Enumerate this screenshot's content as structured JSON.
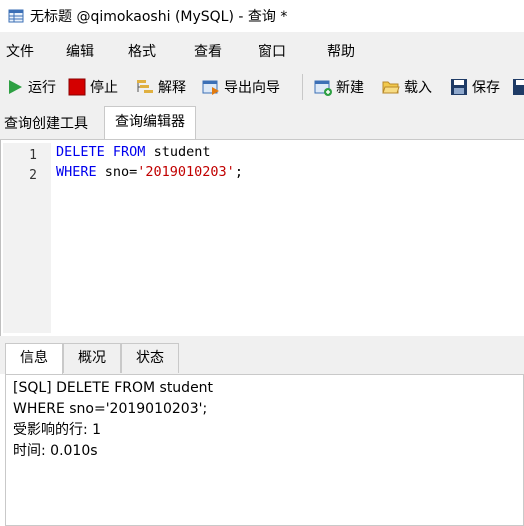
{
  "window": {
    "title": "无标题 @qimokaoshi (MySQL) - 查询 *"
  },
  "menu": [
    "文件",
    "编辑",
    "格式",
    "查看",
    "窗口",
    "帮助"
  ],
  "toolbar": {
    "run": "运行",
    "stop": "停止",
    "explain": "解释",
    "export_wizard": "导出向导",
    "new": "新建",
    "load": "载入",
    "save": "保存"
  },
  "tabs": {
    "query_builder": "查询创建工具",
    "query_editor": "查询编辑器"
  },
  "editor": {
    "line_numbers": [
      "1",
      "2"
    ],
    "lines": [
      [
        {
          "t": "DELETE",
          "k": "kw"
        },
        {
          "t": " ",
          "k": ""
        },
        {
          "t": "FROM",
          "k": "kw"
        },
        {
          "t": " student",
          "k": ""
        }
      ],
      [
        {
          "t": "WHERE",
          "k": "kw"
        },
        {
          "t": " sno=",
          "k": ""
        },
        {
          "t": "'2019010203'",
          "k": "str"
        },
        {
          "t": ";",
          "k": ""
        }
      ]
    ]
  },
  "bottom_tabs": {
    "info": "信息",
    "profile": "概况",
    "status": "状态"
  },
  "info": {
    "lines": [
      "[SQL] DELETE FROM student",
      "WHERE sno='2019010203';",
      "受影响的行: 1",
      "时间: 0.010s"
    ]
  },
  "colors": {
    "keyword": "#0000ee",
    "string": "#c10000",
    "run_icon": "#2ea043",
    "stop_icon": "#d40000"
  }
}
